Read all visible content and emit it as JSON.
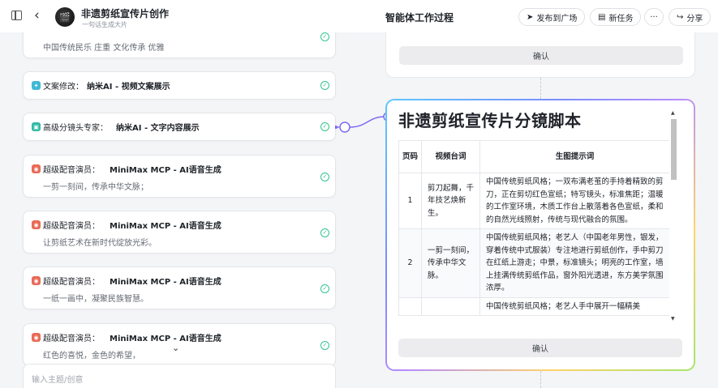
{
  "header": {
    "app_title": "非遗剪纸宣传片创作",
    "app_subtitle": "一句话生成大片",
    "center_title": "智能体工作过程",
    "publish_label": "发布到广场",
    "new_task_label": "新任务",
    "more_label": "···",
    "share_label": "分享"
  },
  "workflow": {
    "top_partial": {
      "desc": "中国传统民乐 庄重 文化传承 优雅"
    },
    "items": [
      {
        "role": "文案修改：",
        "tool": "纳米AI - 视频文案展示",
        "desc": ""
      },
      {
        "role": "高级分镜头专家：",
        "tool": "纳米AI - 文字内容展示",
        "desc": ""
      },
      {
        "role": "超级配音演员：",
        "tool": "MiniMax MCP - AI语音生成",
        "desc": "一剪一刻间，传承中华文脉；"
      },
      {
        "role": "超级配音演员：",
        "tool": "MiniMax MCP - AI语音生成",
        "desc": "让剪纸艺术在新时代绽放光彩。"
      },
      {
        "role": "超级配音演员：",
        "tool": "MiniMax MCP - AI语音生成",
        "desc": "一纸一画中，凝聚民族智慧。"
      },
      {
        "role": "超级配音演员：",
        "tool": "MiniMax MCP - AI语音生成",
        "desc": "红色的喜悦，金色的希望，"
      }
    ],
    "input_placeholder": "输入主题/创意"
  },
  "canvas": {
    "top_confirm_label": "确认",
    "doc_title": "非遗剪纸宣传片分镜脚本",
    "table": {
      "headers": [
        "页码",
        "视频台词",
        "生图提示词"
      ],
      "rows": [
        {
          "page": "1",
          "line": "剪刀起舞，千年技艺焕新生。",
          "prompt": "中国传统剪纸风格；一双布满老茧的手持着精致的剪刀，正在剪切红色宣纸；特写镜头，标准焦距；温暖的工作室环境，木质工作台上散落着各色宣纸，柔和的自然光线照射，传统与现代融合的氛围。"
        },
        {
          "page": "2",
          "line": "一剪一刻间，传承中华文脉。",
          "prompt": "中国传统剪纸风格；老艺人（中国老年男性，银发，穿着传统中式服装）专注地进行剪纸创作，手中剪刀在红纸上游走；中景，标准镜头；明亮的工作室，墙上挂满传统剪纸作品，窗外阳光透进，东方美学氛围浓厚。"
        },
        {
          "page": "",
          "line": "",
          "prompt": "中国传统剪纸风格；老艺人手中展开一幅精美"
        }
      ]
    },
    "bottom_confirm_label": "确认"
  }
}
